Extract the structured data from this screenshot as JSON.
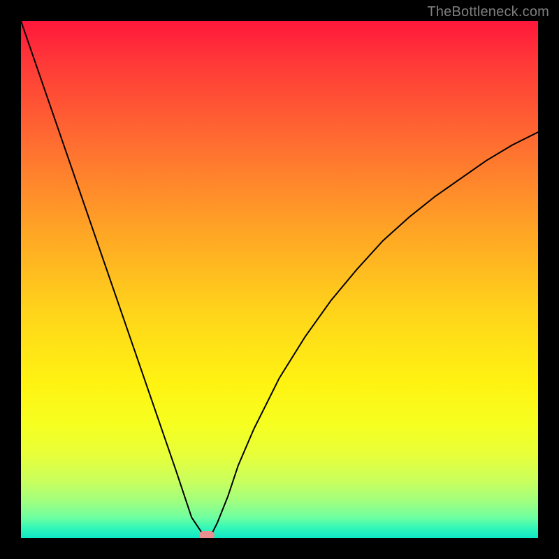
{
  "watermark": "TheBottleneck.com",
  "chart_data": {
    "type": "line",
    "title": "",
    "xlabel": "",
    "ylabel": "",
    "xlim": [
      0,
      100
    ],
    "ylim": [
      0,
      100
    ],
    "grid": false,
    "legend": false,
    "annotations": [],
    "series": [
      {
        "name": "bottleneck-curve",
        "x": [
          0,
          5,
          10,
          15,
          20,
          25,
          30,
          33,
          35,
          36,
          37,
          38,
          40,
          42,
          45,
          50,
          55,
          60,
          65,
          70,
          75,
          80,
          85,
          90,
          95,
          100
        ],
        "values": [
          100,
          85.5,
          71,
          56.5,
          42,
          27.5,
          13,
          4,
          1,
          0,
          1,
          3,
          8,
          14,
          21,
          31,
          39,
          46,
          52,
          57.5,
          62,
          66,
          69.5,
          73,
          76,
          78.5
        ]
      }
    ],
    "marker": {
      "x": 36,
      "y": 0
    },
    "colors": {
      "gradient_top": "#ff173b",
      "gradient_mid1": "#ffa924",
      "gradient_mid2": "#fff312",
      "gradient_bottom": "#0de8c6",
      "curve": "#000000",
      "marker": "#e88f8f",
      "frame": "#000000"
    }
  }
}
